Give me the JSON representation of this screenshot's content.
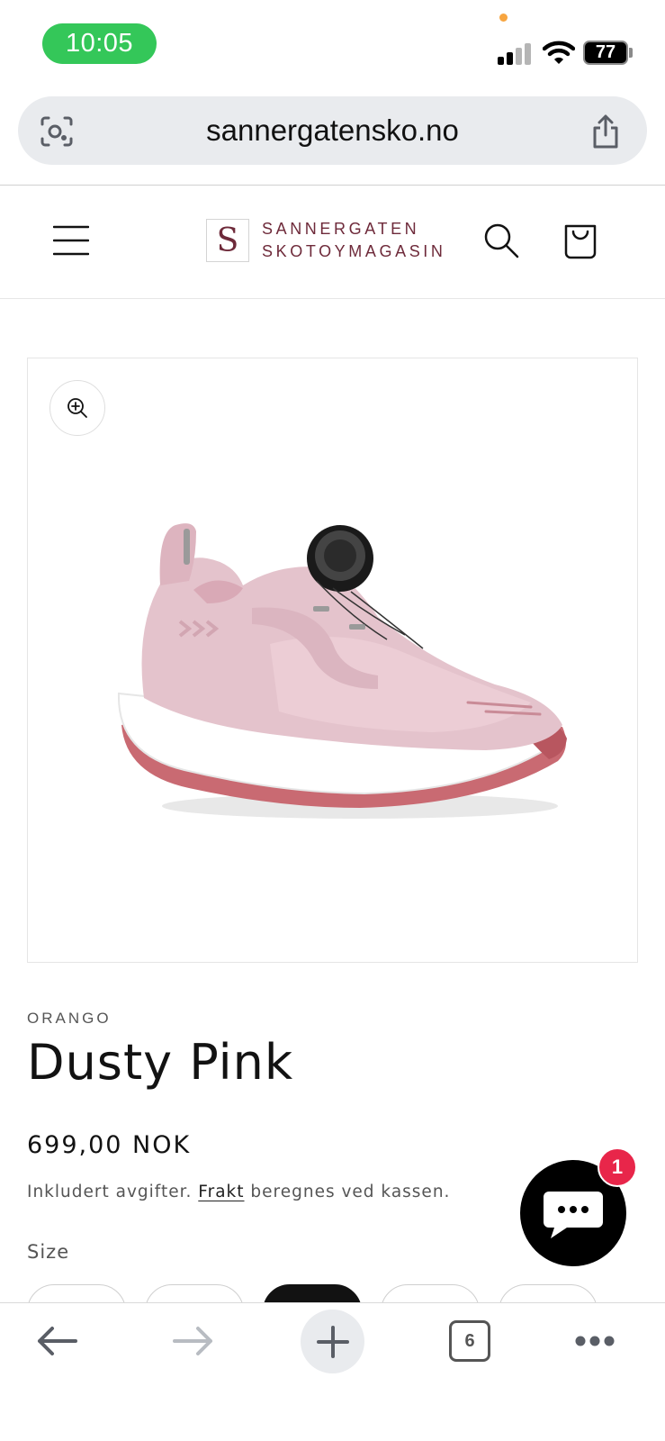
{
  "status_bar": {
    "time": "10:05",
    "battery": "77"
  },
  "browser": {
    "url": "sannergatensko.no",
    "tab_count": "6"
  },
  "store": {
    "logo_letter": "S",
    "logo_line1": "SANNERGATEN",
    "logo_line2": "SKOTOYMAGASIN"
  },
  "product": {
    "vendor": "ORANGO",
    "title": "Dusty Pink",
    "price": "699,00 NOK",
    "tax_prefix": "Inkludert avgifter.",
    "shipping_link": "Frakt",
    "tax_suffix": "beregnes ved kassen.",
    "size_label": "Size",
    "size_options_visible": 5,
    "selected_size_index": 2
  },
  "chat": {
    "badge_count": "1"
  },
  "icons": {
    "hamburger": "menu-icon",
    "search": "search-icon",
    "cart": "cart-icon",
    "zoom": "zoom-in-icon",
    "chat": "chat-bubble-icon",
    "back": "arrow-left-icon",
    "forward": "arrow-right-icon",
    "new_tab": "plus-icon",
    "more": "more-dots-icon",
    "share": "share-icon",
    "visual_search": "camera-search-icon"
  },
  "colors": {
    "brand": "#6e2a3a",
    "time_pill": "#34c759",
    "chat_badge": "#e8264a",
    "shoe_pink": "#e4c3cc"
  }
}
